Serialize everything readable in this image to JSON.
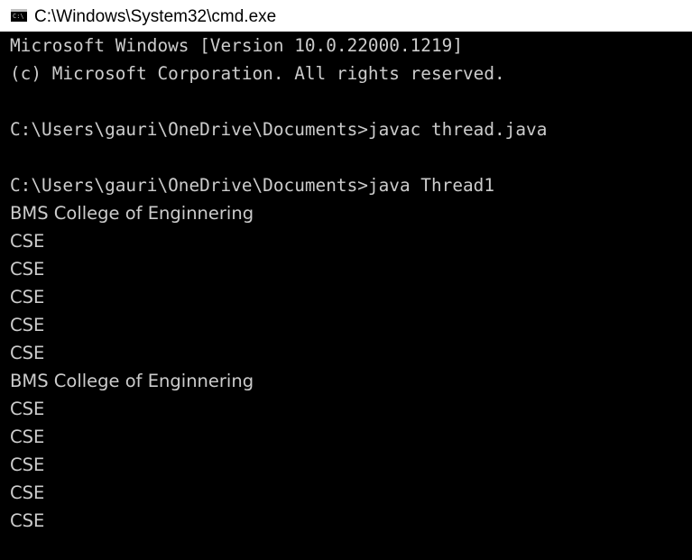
{
  "window": {
    "title": "C:\\Windows\\System32\\cmd.exe",
    "icon": "cmd-icon"
  },
  "colors": {
    "console_background": "#000000",
    "console_text": "#cccccc",
    "titlebar_background": "#ffffff"
  },
  "console": {
    "header_line_1": "Microsoft Windows [Version 10.0.22000.1219]",
    "header_line_2": "(c) Microsoft Corporation. All rights reserved.",
    "command_1": "C:\\Users\\gauri\\OneDrive\\Documents>javac thread.java",
    "command_2": "C:\\Users\\gauri\\OneDrive\\Documents>java Thread1",
    "output": [
      "BMS College of Enginnering",
      "CSE",
      "CSE",
      "CSE",
      "CSE",
      "CSE",
      "BMS College of Enginnering",
      "CSE",
      "CSE",
      "CSE",
      "CSE",
      "CSE"
    ]
  }
}
